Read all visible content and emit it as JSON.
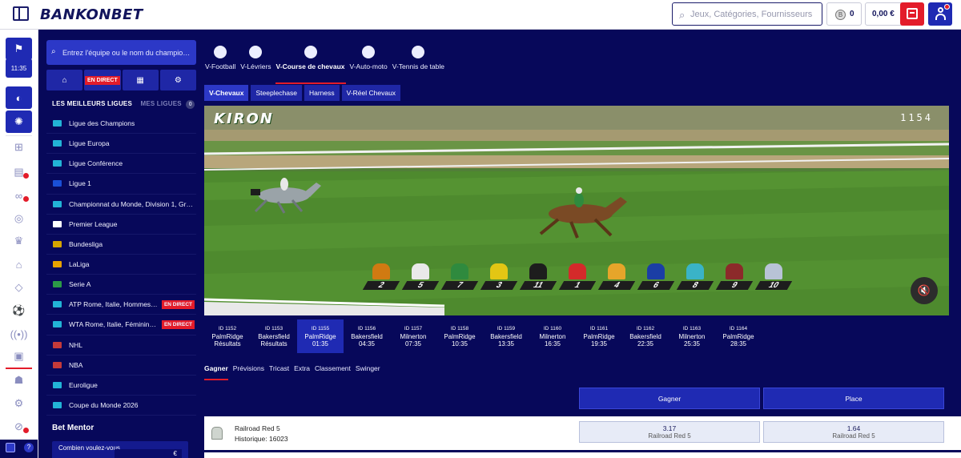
{
  "header": {
    "logo": "BANKONBET",
    "search_placeholder": "Jeux, Catégories, Fournisseurs",
    "coins": "0",
    "balance": "0,00 €",
    "notification_count": "1"
  },
  "rail": {
    "clock": "11:35"
  },
  "sidebar": {
    "search_placeholder": "Entrez l'équipe ou le nom du champio…",
    "live_label": "EN DIRECT",
    "top_leagues": "LES MEILLEURS LIGUES",
    "my_leagues": "MES LIGUES",
    "my_leagues_count": "0",
    "leagues": [
      {
        "name": "Ligue des Champions",
        "flag": "#22b3d6"
      },
      {
        "name": "Ligue Europa",
        "flag": "#22b3d6"
      },
      {
        "name": "Ligue Conférence",
        "flag": "#22b3d6"
      },
      {
        "name": "Ligue 1",
        "flag": "#1a4fd6"
      },
      {
        "name": "Championnat du Monde, Division 1, Gr…",
        "flag": "#22b3d6"
      },
      {
        "name": "Premier League",
        "flag": "#ffffff"
      },
      {
        "name": "Bundesliga",
        "flag": "#d5a400"
      },
      {
        "name": "LaLiga",
        "flag": "#e8a200"
      },
      {
        "name": "Serie A",
        "flag": "#2c9a47"
      },
      {
        "name": "ATP Rome, Italie, Hommes…",
        "flag": "#22b3d6",
        "live": "EN DIRECT"
      },
      {
        "name": "WTA Rome, Italie, Féminin…",
        "flag": "#22b3d6",
        "live": "EN DIRECT"
      },
      {
        "name": "NHL",
        "flag": "#c43a3a"
      },
      {
        "name": "NBA",
        "flag": "#c43a3a"
      },
      {
        "name": "Euroligue",
        "flag": "#22b3d6"
      },
      {
        "name": "Coupe du Monde 2026",
        "flag": "#22b3d6"
      }
    ],
    "mentor_title": "Bet Mentor",
    "mentor_question": "Combien voulez-vous",
    "mentor_currency": "€"
  },
  "main": {
    "vsports": [
      "V-Football",
      "V-Lévriers",
      "V-Course de chevaux",
      "V-Auto-moto",
      "V-Tennis de table"
    ],
    "subtabs": [
      "V-Chevaux",
      "Steeplechase",
      "Harness",
      "V-Réel Chevaux"
    ],
    "video": {
      "provider": "KIRON",
      "race_number": "1154",
      "runners": [
        {
          "num": "2",
          "color": "#d07a12"
        },
        {
          "num": "5",
          "color": "#e9e9e9"
        },
        {
          "num": "7",
          "color": "#2f8a3e"
        },
        {
          "num": "3",
          "color": "#e3c614"
        },
        {
          "num": "11",
          "color": "#1d1d1d"
        },
        {
          "num": "1",
          "color": "#d42a2a"
        },
        {
          "num": "4",
          "color": "#e6a52a"
        },
        {
          "num": "6",
          "color": "#1b3ea5"
        },
        {
          "num": "8",
          "color": "#3ab3c7"
        },
        {
          "num": "9",
          "color": "#8c2a2a"
        },
        {
          "num": "10",
          "color": "#b8c3d6"
        }
      ]
    },
    "schedule": [
      {
        "id": "ID 1152",
        "track": "PalmRidge",
        "time": "Résultats"
      },
      {
        "id": "ID 1153",
        "track": "Bakersfield",
        "time": "Résultats"
      },
      {
        "id": "ID 1155",
        "track": "PalmRidge",
        "time": "01:35",
        "active": true
      },
      {
        "id": "ID 1156",
        "track": "Bakersfield",
        "time": "04:35"
      },
      {
        "id": "ID 1157",
        "track": "Milnerton",
        "time": "07:35"
      },
      {
        "id": "ID 1158",
        "track": "PalmRidge",
        "time": "10:35"
      },
      {
        "id": "ID 1159",
        "track": "Bakersfield",
        "time": "13:35"
      },
      {
        "id": "ID 1160",
        "track": "Milnerton",
        "time": "16:35"
      },
      {
        "id": "ID 1161",
        "track": "PalmRidge",
        "time": "19:35"
      },
      {
        "id": "ID 1162",
        "track": "Bakersfield",
        "time": "22:35"
      },
      {
        "id": "ID 1163",
        "track": "Milnerton",
        "time": "25:35"
      },
      {
        "id": "ID 1164",
        "track": "PalmRidge",
        "time": "28:35"
      }
    ],
    "bet_tabs": [
      "Gagner",
      "Prévisions",
      "Tricast",
      "Extra",
      "Classement",
      "Swinger"
    ],
    "columns": {
      "win": "Gagner",
      "place": "Place"
    },
    "runner_row": {
      "name": "Railroad Red 5",
      "history": "Historique: 16023",
      "win_odds": "3.17",
      "place_odds": "1.64",
      "odds_label": "Railroad Red 5"
    }
  }
}
